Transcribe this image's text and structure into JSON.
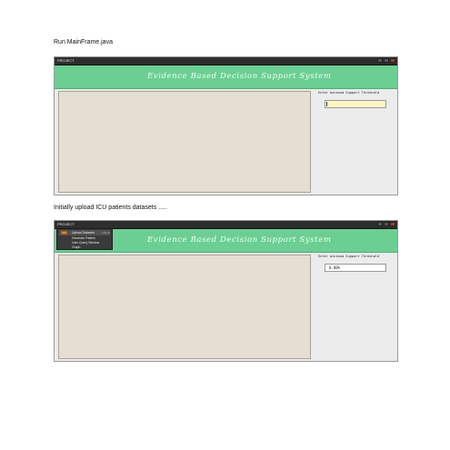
{
  "captions": {
    "first": "Run MainFrame.java",
    "second": "Initially upload ICU patients datasets ....."
  },
  "window1": {
    "menu_label": "PROJECT",
    "banner_title": "Evidence Based Decision Support System",
    "threshold_label": "Enter minimum Support Threshold",
    "threshold_value": ""
  },
  "window2": {
    "menu_label": "PROJECT",
    "banner_title": "Evidence Based Decision Support System",
    "threshold_label": "Enter minimum Support Threshold",
    "threshold_value": "0.80%",
    "menu_items": [
      {
        "label": "Upload Datasets",
        "shortcut": "Ctrl+D"
      },
      {
        "label": "Generate Pattern",
        "shortcut": ""
      },
      {
        "label": "User Query Window",
        "shortcut": ""
      },
      {
        "label": "Graph",
        "shortcut": ""
      }
    ]
  },
  "colors": {
    "banner": "#6bcf92",
    "output_area": "#e5ded3",
    "titlebar": "#2e2e2e",
    "active_field": "#fff6c4"
  }
}
